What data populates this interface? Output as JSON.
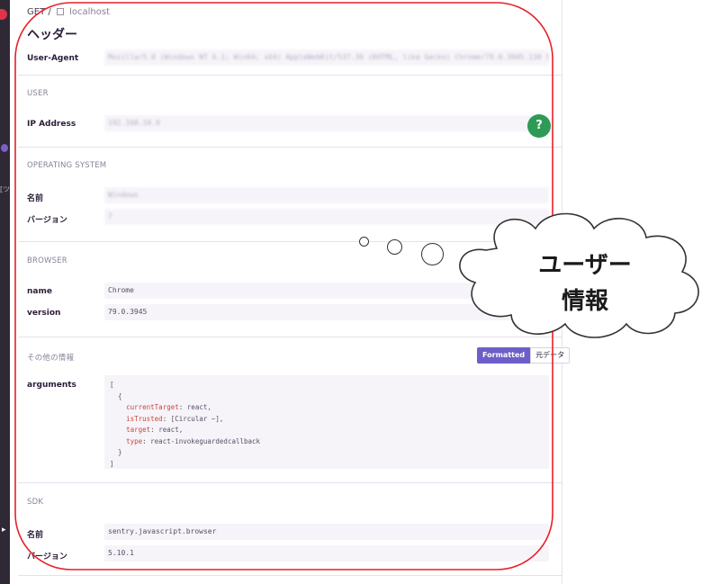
{
  "request": {
    "method": "GET /",
    "host": "localhost"
  },
  "title": "ヘッダー",
  "headers": {
    "user_agent_label": "User-Agent",
    "user_agent_value": "Mozilla/5.0 (Windows NT 6.1; Win64; x64) AppleWebKit/537.36 (KHTML, like Gecko) Chrome/79.0.3945.130 Safari/537.36"
  },
  "user": {
    "title": "USER",
    "ip_label": "IP Address",
    "ip_value": "192.168.10.9"
  },
  "os": {
    "title": "OPERATING SYSTEM",
    "name_label": "名前",
    "name_value": "Windows",
    "version_label": "バージョン",
    "version_value": "7"
  },
  "browser": {
    "title": "BROWSER",
    "name_label": "name",
    "name_value": "Chrome",
    "version_label": "version",
    "version_value": "79.0.3945"
  },
  "other": {
    "title": "その他の情報",
    "toggle_formatted": "Formatted",
    "toggle_raw": "元データ",
    "arguments_label": "arguments",
    "code": {
      "open_bracket": "[",
      "open_brace": "  {",
      "rows": [
        {
          "key": "currentTarget",
          "value": "react,"
        },
        {
          "key": "isTrusted",
          "value": "[Circular ~],"
        },
        {
          "key": "target",
          "value": "react,"
        },
        {
          "key": "type",
          "value": "react-invokeguardedcallback"
        }
      ],
      "close_brace": "  }",
      "close_bracket": "]"
    }
  },
  "sdk": {
    "title": "SDK",
    "name_label": "名前",
    "name_value": "sentry.javascript.browser",
    "version_label": "バージョン",
    "version_value": "5.10.1"
  },
  "help_button": "?",
  "callout": {
    "line1": "ユーザー",
    "line2": "情報"
  },
  "sidebar": {
    "fragment": "[ツ"
  },
  "colors": {
    "accent": "#6c5fc7",
    "help": "#2e9a55",
    "annotation": "#e8202a"
  }
}
